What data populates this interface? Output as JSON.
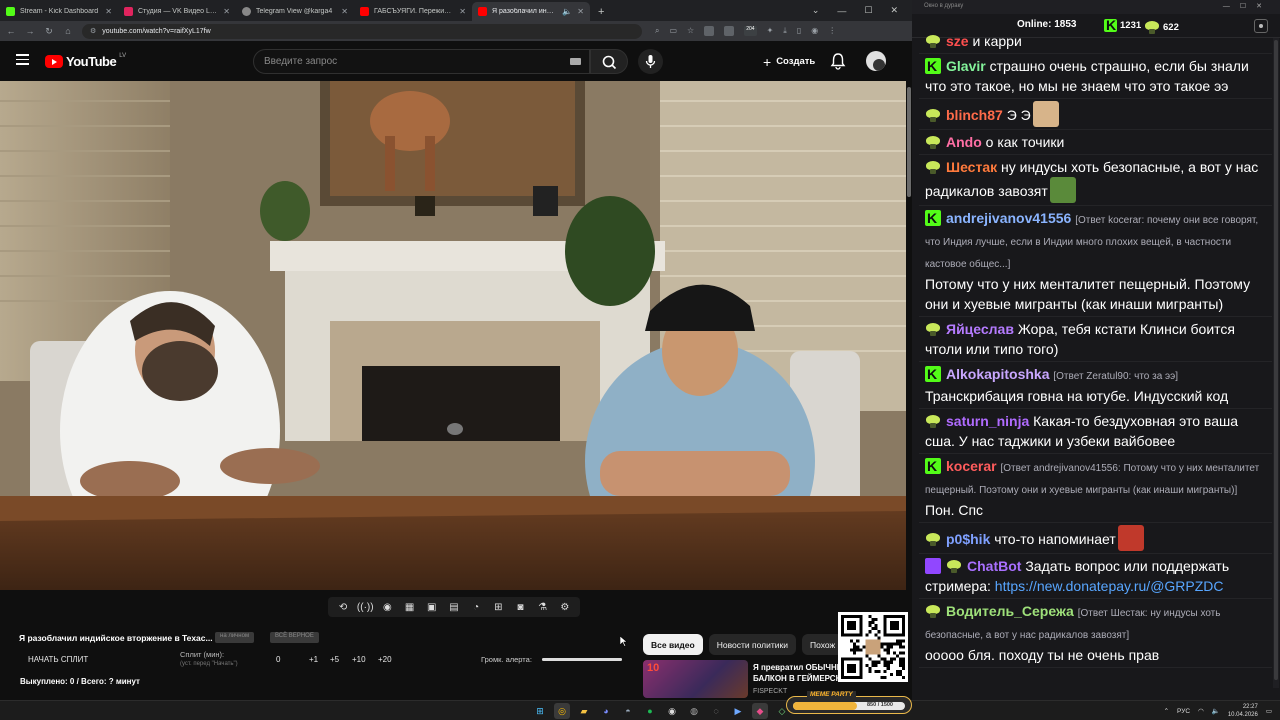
{
  "browser": {
    "tabs": [
      {
        "title": "Stream - Kick Dashboard",
        "color": "#53fc18",
        "active": false
      },
      {
        "title": "Студия — VK Видео Live",
        "color": "#e0245e",
        "active": false
      },
      {
        "title": "Telegram View @karga4",
        "color": "#888888",
        "active": false
      },
      {
        "title": "ГАБСЪУЯГИ. Пережить индес",
        "color": "#ff0000",
        "active": false
      },
      {
        "title": "Я разоблачил индийское о",
        "color": "#ff0000",
        "active": true
      }
    ],
    "url": "youtube.com/watch?v=raifXyL17fw",
    "ext_badge": "204"
  },
  "youtube": {
    "logo_text": "YouTube",
    "country_code": "LV",
    "search_placeholder": "Введите запрос",
    "create_label": "Создать"
  },
  "player_tools": [
    "loop-icon",
    "broadcast-icon",
    "eye-icon",
    "film-icon",
    "pip-icon",
    "subtitles-icon",
    "speed-icon",
    "add-icon",
    "camera-icon",
    "flask-icon",
    "gear-icon"
  ],
  "split": {
    "title": "Я разоблачил индийское вторжение в Texac...",
    "chip_1": "на личном",
    "chip_2": "ВСЁ ВЕРНОЕ",
    "start_label": "НАЧАТЬ СПЛИТ",
    "minutes_label": "Сплит (мин):",
    "minutes_hint": "(уст. перед \"Начать\")",
    "minutes_value": "0",
    "steps": [
      "+1",
      "+5",
      "+10",
      "+20"
    ],
    "alert_volume_label": "Громк. алерта:",
    "alert_volume": 1.0,
    "bought": "Выкуплено: 0 / Всего: ? минут"
  },
  "recommendations": {
    "chips": [
      "Все видео",
      "Новости политики",
      "Похож"
    ],
    "video": {
      "thumb_number": "10",
      "title_line1": "Я превратил ОБЫЧНЫЙ",
      "title_line2": "БАЛКОН В ГЕЙМЕРСК",
      "channel": "FISPECKT"
    }
  },
  "chat": {
    "window_title": "Окно в дураку",
    "online_label": "Online:",
    "online_count": "1853",
    "kick_count": "1231",
    "vk_count": "622",
    "messages": [
      {
        "badge": "f",
        "user": "sze",
        "color": "#ff4f4f",
        "text": "и карри"
      },
      {
        "badge": "k",
        "user": "Glavir",
        "color": "#83f29a",
        "text": "страшно очень страшно, если бы знали что это такое, но мы не знаем что это такое ээ"
      },
      {
        "badge": "f",
        "user": "blinch87",
        "color": "#ff6b4a",
        "text": "Э Э",
        "emote": "#d7b48a"
      },
      {
        "badge": "f",
        "user": "Ando",
        "color": "#ff6fa5",
        "text": "о как точики"
      },
      {
        "badge": "f",
        "user": "Шестак",
        "color": "#ff7a3c",
        "text": "ну индусы хоть безопасные, а вот у нас радикалов завозят",
        "emote": "#5a8a3a"
      },
      {
        "badge": "k",
        "user": "andrejivanov41556",
        "color": "#8ab4ff",
        "reply": "[Ответ kocerar: почему они все говорят, что Индия лучше, если в Индии много плохих вещей, в частности кастовое общес...]",
        "text": "Потому что у них менталитет пещерный. Поэтому они и хуевые мигранты (как инаши мигранты)"
      },
      {
        "badge": "f",
        "user": "Яйцеслав",
        "color": "#b57bff",
        "text": "Жора, тебя кстати Клинси боится чтоли или типо того)"
      },
      {
        "badge": "k",
        "user": "Alkokapitoshka",
        "color": "#c9a7ff",
        "reply": "[Ответ Zeratul90: что за ээ]",
        "text": "Транскрибация говна на ютубе. Индусский код"
      },
      {
        "badge": "f",
        "user": "saturn_ninja",
        "color": "#b06bff",
        "text": "Какая-то бездуховная это ваша сша. У нас таджики и узбеки вайбовее"
      },
      {
        "badge": "k",
        "user": "kocerar",
        "color": "#ff5c5c",
        "reply": "[Ответ andrejivanov41556: Потому что у них менталитет пещерный. Поэтому они и хуевые мигранты (как инаши мигранты)]",
        "text": "Пон. Спс"
      },
      {
        "badge": "f",
        "user": "p0$hik",
        "color": "#7fa0ff",
        "text": "что-то напоминает",
        "emote": "#c0392b"
      },
      {
        "badge": "if",
        "user": "ChatBot",
        "color": "#a970ff",
        "text": "Задать вопрос или поддержать стримера:",
        "link": "https://new.donatepay.ru/@GRPZDC"
      },
      {
        "badge": "f",
        "user": "Водитель_Сережа",
        "color": "#9ee07a",
        "reply": "[Ответ Шестак: ну индусы хоть безопасные, а вот у нас радикалов завозят]",
        "text": "ооооо бля. походу ты не очень прав"
      }
    ]
  },
  "meme_party": {
    "label": "MEME PARTY",
    "value_text": "850 / 1500",
    "progress": 0.567
  },
  "taskbar": {
    "lang": "РУС",
    "time": "22:27",
    "date": "10.04.2026"
  }
}
